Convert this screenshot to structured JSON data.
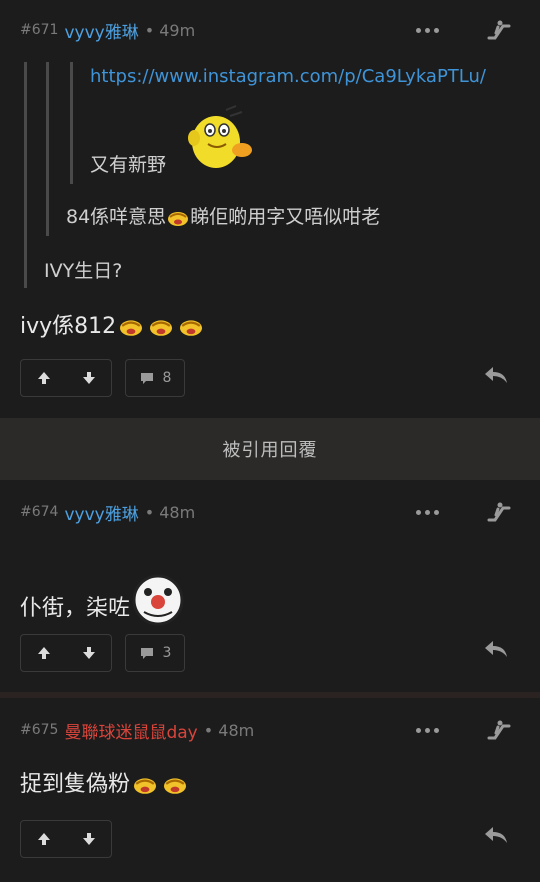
{
  "posts": [
    {
      "num": "#671",
      "user": "vyvy雅琳",
      "time": "• 49m",
      "quote3_link": "https://www.instagram.com/p/Ca9LykaPTLu/",
      "quote3_text": "又有新野",
      "quote2_text_a": "84係咩意思",
      "quote2_text_b": "睇佢啲用字又唔似咁老",
      "quote1_text": "IVY生日?",
      "body": "ivy係812",
      "comments": "8"
    },
    {
      "num": "#674",
      "user": "vyvy雅琳",
      "time": "• 48m",
      "body": "仆街，柒咗",
      "comments": "3"
    },
    {
      "num": "#675",
      "user": "曼聯球迷鼠鼠day",
      "time": "• 48m",
      "body": "捉到隻偽粉"
    }
  ],
  "divider_label": "被引用回覆",
  "icons": {
    "more": "more-dots-icon",
    "escalator": "escalator-icon",
    "upvote": "arrow-up-icon",
    "downvote": "arrow-down-icon",
    "comment": "comment-bubble-icon",
    "reply": "reply-arrow-icon"
  },
  "colors": {
    "background": "#1c1c1c",
    "username_blue": "#4da0e0",
    "username_red": "#d9443b",
    "link": "#3f94d8"
  }
}
